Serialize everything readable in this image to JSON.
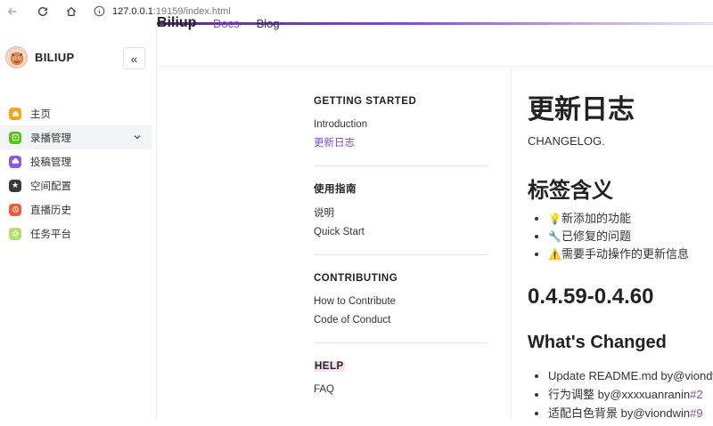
{
  "browser": {
    "url_host": "127.0.0.1",
    "url_rest": ":19159/index.html"
  },
  "app": {
    "brand_name": "BILIUP",
    "collapse_glyph": "«",
    "menu": [
      {
        "label": "主页",
        "icon": "home-icon",
        "color": "#f5a623",
        "active": false
      },
      {
        "label": "录播管理",
        "icon": "record-icon",
        "color": "#52c41a",
        "active": true
      },
      {
        "label": "投稿管理",
        "icon": "upload-cloud-icon",
        "color": "#8e5bd6",
        "active": false
      },
      {
        "label": "空间配置",
        "icon": "star-icon",
        "color": "#3a3a3a",
        "active": false
      },
      {
        "label": "直播历史",
        "icon": "history-icon",
        "color": "#f05a3c",
        "active": false
      },
      {
        "label": "任务平台",
        "icon": "gear-icon",
        "color": "#b7de6f",
        "active": false
      }
    ]
  },
  "docs_header": {
    "brand": "Biliup",
    "nav_docs": "Docs",
    "nav_blog": "Blog",
    "accent_color": "#7f4fc0"
  },
  "docs_sidebar": {
    "sections": [
      {
        "title": "GETTING STARTED",
        "links": [
          "Introduction",
          "更新日志"
        ]
      },
      {
        "title": "使用指南",
        "links": [
          "说明",
          "Quick Start"
        ]
      },
      {
        "title": "CONTRIBUTING",
        "links": [
          "How to Contribute",
          "Code of Conduct"
        ]
      },
      {
        "title": "HELP",
        "links": [
          "FAQ"
        ]
      }
    ]
  },
  "content": {
    "title": "更新日志",
    "subtitle": "CHANGELOG.",
    "tags_heading": "标签含义",
    "tags": [
      {
        "emoji": "💡",
        "text": "新添加的功能"
      },
      {
        "emoji": "🔧",
        "text": "已修复的问题"
      },
      {
        "emoji": "⚠️",
        "text": "需要手动操作的更新信息"
      }
    ],
    "version": "0.4.59-0.4.60",
    "whats_changed": "What's Changed",
    "changes": [
      {
        "text": "Update README.md by ",
        "author": "@viondw"
      },
      {
        "text": "行为调整 by ",
        "author": "@xxxxuanran",
        "suffix": " in ",
        "link": "#2"
      },
      {
        "text": "适配白色背景 by ",
        "author": "@viondw",
        "suffix": " in ",
        "link": "#9"
      }
    ]
  }
}
